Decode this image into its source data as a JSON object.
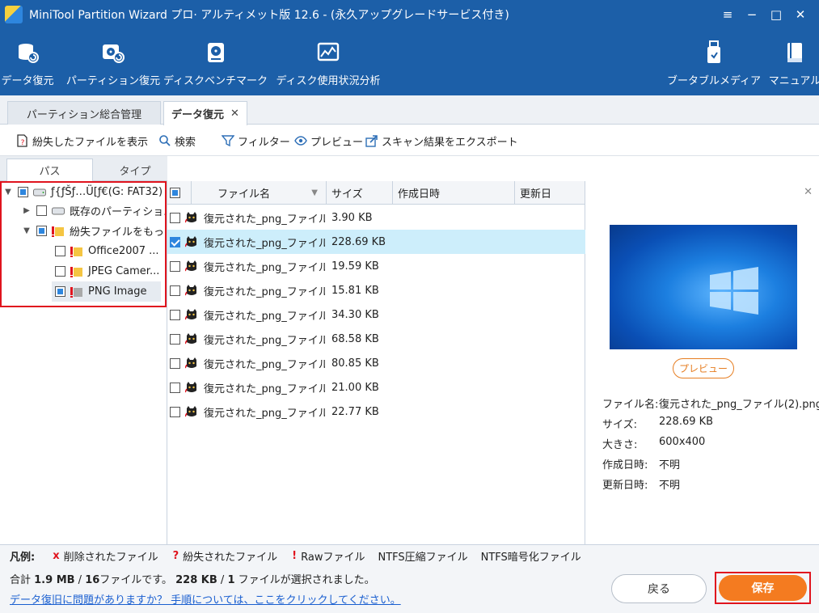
{
  "window": {
    "title": "MiniTool Partition Wizard プロ· アルティメット版 12.6 - (永久アップグレードサービス付き)",
    "controls": [
      "≡",
      "−",
      "□",
      "✕"
    ]
  },
  "toolbar": {
    "items": [
      {
        "label": "データ復元",
        "icon": "data-recovery-icon"
      },
      {
        "label": "パーティション復元",
        "icon": "partition-recovery-icon"
      },
      {
        "label": "ディスクベンチマーク",
        "icon": "disk-benchmark-icon"
      },
      {
        "label": "ディスク使用状況分析",
        "icon": "space-analyzer-icon"
      },
      {
        "label": "ブータブルメディア",
        "icon": "bootable-media-icon"
      },
      {
        "label": "マニュアル",
        "icon": "manual-icon"
      }
    ]
  },
  "tabs": [
    {
      "label": "パーティション総合管理",
      "active": false
    },
    {
      "label": "データ復元",
      "active": true,
      "close": "✕"
    }
  ],
  "actions": [
    {
      "label": "紛失したファイルを表示",
      "icon": "show-lost-files-icon"
    },
    {
      "label": "検索",
      "icon": "search-icon"
    },
    {
      "label": "フィルター",
      "icon": "filter-icon"
    },
    {
      "label": "プレビュー",
      "icon": "eye-icon"
    },
    {
      "label": "スキャン結果をエクスポート",
      "icon": "export-icon"
    }
  ],
  "side_tabs": [
    {
      "label": "パス",
      "active": true
    },
    {
      "label": "タイプ",
      "active": false
    }
  ],
  "tree": [
    {
      "label": "ƒ{ƒŠƒ…Ü[ƒ€(G: FAT32)",
      "arrow": "expanded",
      "check": "partial",
      "icon": "drive-icon"
    },
    {
      "label": "既存のパーティショ...",
      "arrow": "collapsed",
      "check": "none",
      "icon": "drive-icon"
    },
    {
      "label": "紛失ファイルをもっ...",
      "arrow": "expanded",
      "check": "partial",
      "icon": "lost-folder-icon"
    },
    {
      "label": "Office2007 ...",
      "arrow": "",
      "check": "none",
      "icon": "lost-folder-icon"
    },
    {
      "label": "JPEG Camer...",
      "arrow": "",
      "check": "none",
      "icon": "lost-folder-icon"
    },
    {
      "label": "PNG Image",
      "arrow": "",
      "check": "partial",
      "icon": "lost-folder-icon"
    }
  ],
  "file_list": {
    "columns": [
      "ファイル名",
      "サイズ",
      "作成日時",
      "更新日"
    ],
    "rows": [
      {
        "name": "復元された_png_ファイル(...",
        "size": "3.90 KB",
        "checked": false
      },
      {
        "name": "復元された_png_ファイル(...",
        "size": "228.69 KB",
        "checked": true
      },
      {
        "name": "復元された_png_ファイル(...",
        "size": "19.59 KB",
        "checked": false
      },
      {
        "name": "復元された_png_ファイル(...",
        "size": "15.81 KB",
        "checked": false
      },
      {
        "name": "復元された_png_ファイル(...",
        "size": "34.30 KB",
        "checked": false
      },
      {
        "name": "復元された_png_ファイル(...",
        "size": "68.58 KB",
        "checked": false
      },
      {
        "name": "復元された_png_ファイル(...",
        "size": "80.85 KB",
        "checked": false
      },
      {
        "name": "復元された_png_ファイル(...",
        "size": "21.00 KB",
        "checked": false
      },
      {
        "name": "復元された_png_ファイル(...",
        "size": "22.77 KB",
        "checked": false
      }
    ]
  },
  "preview": {
    "close": "✕",
    "button": "プレビュー",
    "info": [
      {
        "label": "ファイル名:",
        "value": "復元された_png_ファイル(2).png"
      },
      {
        "label": "サイズ:",
        "value": "228.69 KB"
      },
      {
        "label": "大きさ:",
        "value": "600x400"
      },
      {
        "label": "作成日時:",
        "value": "不明"
      },
      {
        "label": "更新日時:",
        "value": "不明"
      }
    ]
  },
  "legend": {
    "title": "凡例:",
    "items": [
      {
        "mark": "x",
        "text": "削除されたファイル",
        "color": "#e0141e"
      },
      {
        "mark": "?",
        "text": "紛失されたファイル",
        "color": "#e0141e"
      },
      {
        "mark": "!",
        "text": "Rawファイル",
        "color": "#e0141e"
      },
      {
        "mark": "",
        "text": "NTFS圧縮ファイル",
        "color": "#222222"
      },
      {
        "mark": "",
        "text": "NTFS暗号化ファイル",
        "color": "#222222"
      }
    ]
  },
  "summary": {
    "prefix": "合計 ",
    "total_size": "1.9 MB",
    "sep1": " / ",
    "total_files": "16",
    "mid": "ファイルです。 ",
    "selected_size": "228 KB",
    "sep2": " / ",
    "selected_files": "1",
    "suffix": " ファイルが選択されました。"
  },
  "help_link": "データ復旧に問題がありますか？ 手順については、ここをクリックしてください。",
  "buttons": {
    "back": "戻る",
    "save": "保存"
  },
  "colors": {
    "title_bg": "#1c5fa8",
    "accent": "#2e86de",
    "save": "#f47b20",
    "highlight": "#e0141e",
    "selected_row": "#cdeefb"
  }
}
